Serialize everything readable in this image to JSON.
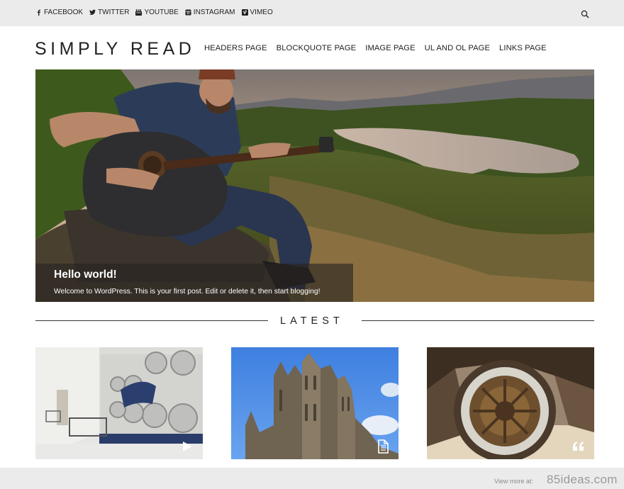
{
  "social": {
    "items": [
      {
        "icon": "facebook-icon",
        "label": "FACEBOOK"
      },
      {
        "icon": "twitter-icon",
        "label": "TWITTER"
      },
      {
        "icon": "youtube-icon",
        "label": "YOUTUBE"
      },
      {
        "icon": "instagram-icon",
        "label": "INSTAGRAM"
      },
      {
        "icon": "vimeo-icon",
        "label": "VIMEO"
      }
    ]
  },
  "header": {
    "logo": "SIMPLY READ",
    "nav": [
      "HEADERS PAGE",
      "BLOCKQUOTE PAGE",
      "IMAGE PAGE",
      "UL AND OL PAGE",
      "LINKS PAGE"
    ]
  },
  "hero": {
    "title": "Hello world!",
    "excerpt": "Welcome to WordPress. This is your first post. Edit or delete it, then start blogging!"
  },
  "latest": {
    "heading": "LATEST",
    "posts": [
      {
        "image": "laundromat-photo",
        "format_icon": "play-icon"
      },
      {
        "image": "cathedral-photo",
        "format_icon": "document-icon"
      },
      {
        "image": "rusty-wheel-photo",
        "format_icon": "quote-icon"
      }
    ]
  },
  "footer": {
    "view_more": "View more at:",
    "site": "85ideas.com"
  },
  "colors": {
    "topbar_bg": "#ebebeb",
    "page_bg": "#ffffff",
    "text": "#222222",
    "caption_overlay": "#28241f"
  }
}
